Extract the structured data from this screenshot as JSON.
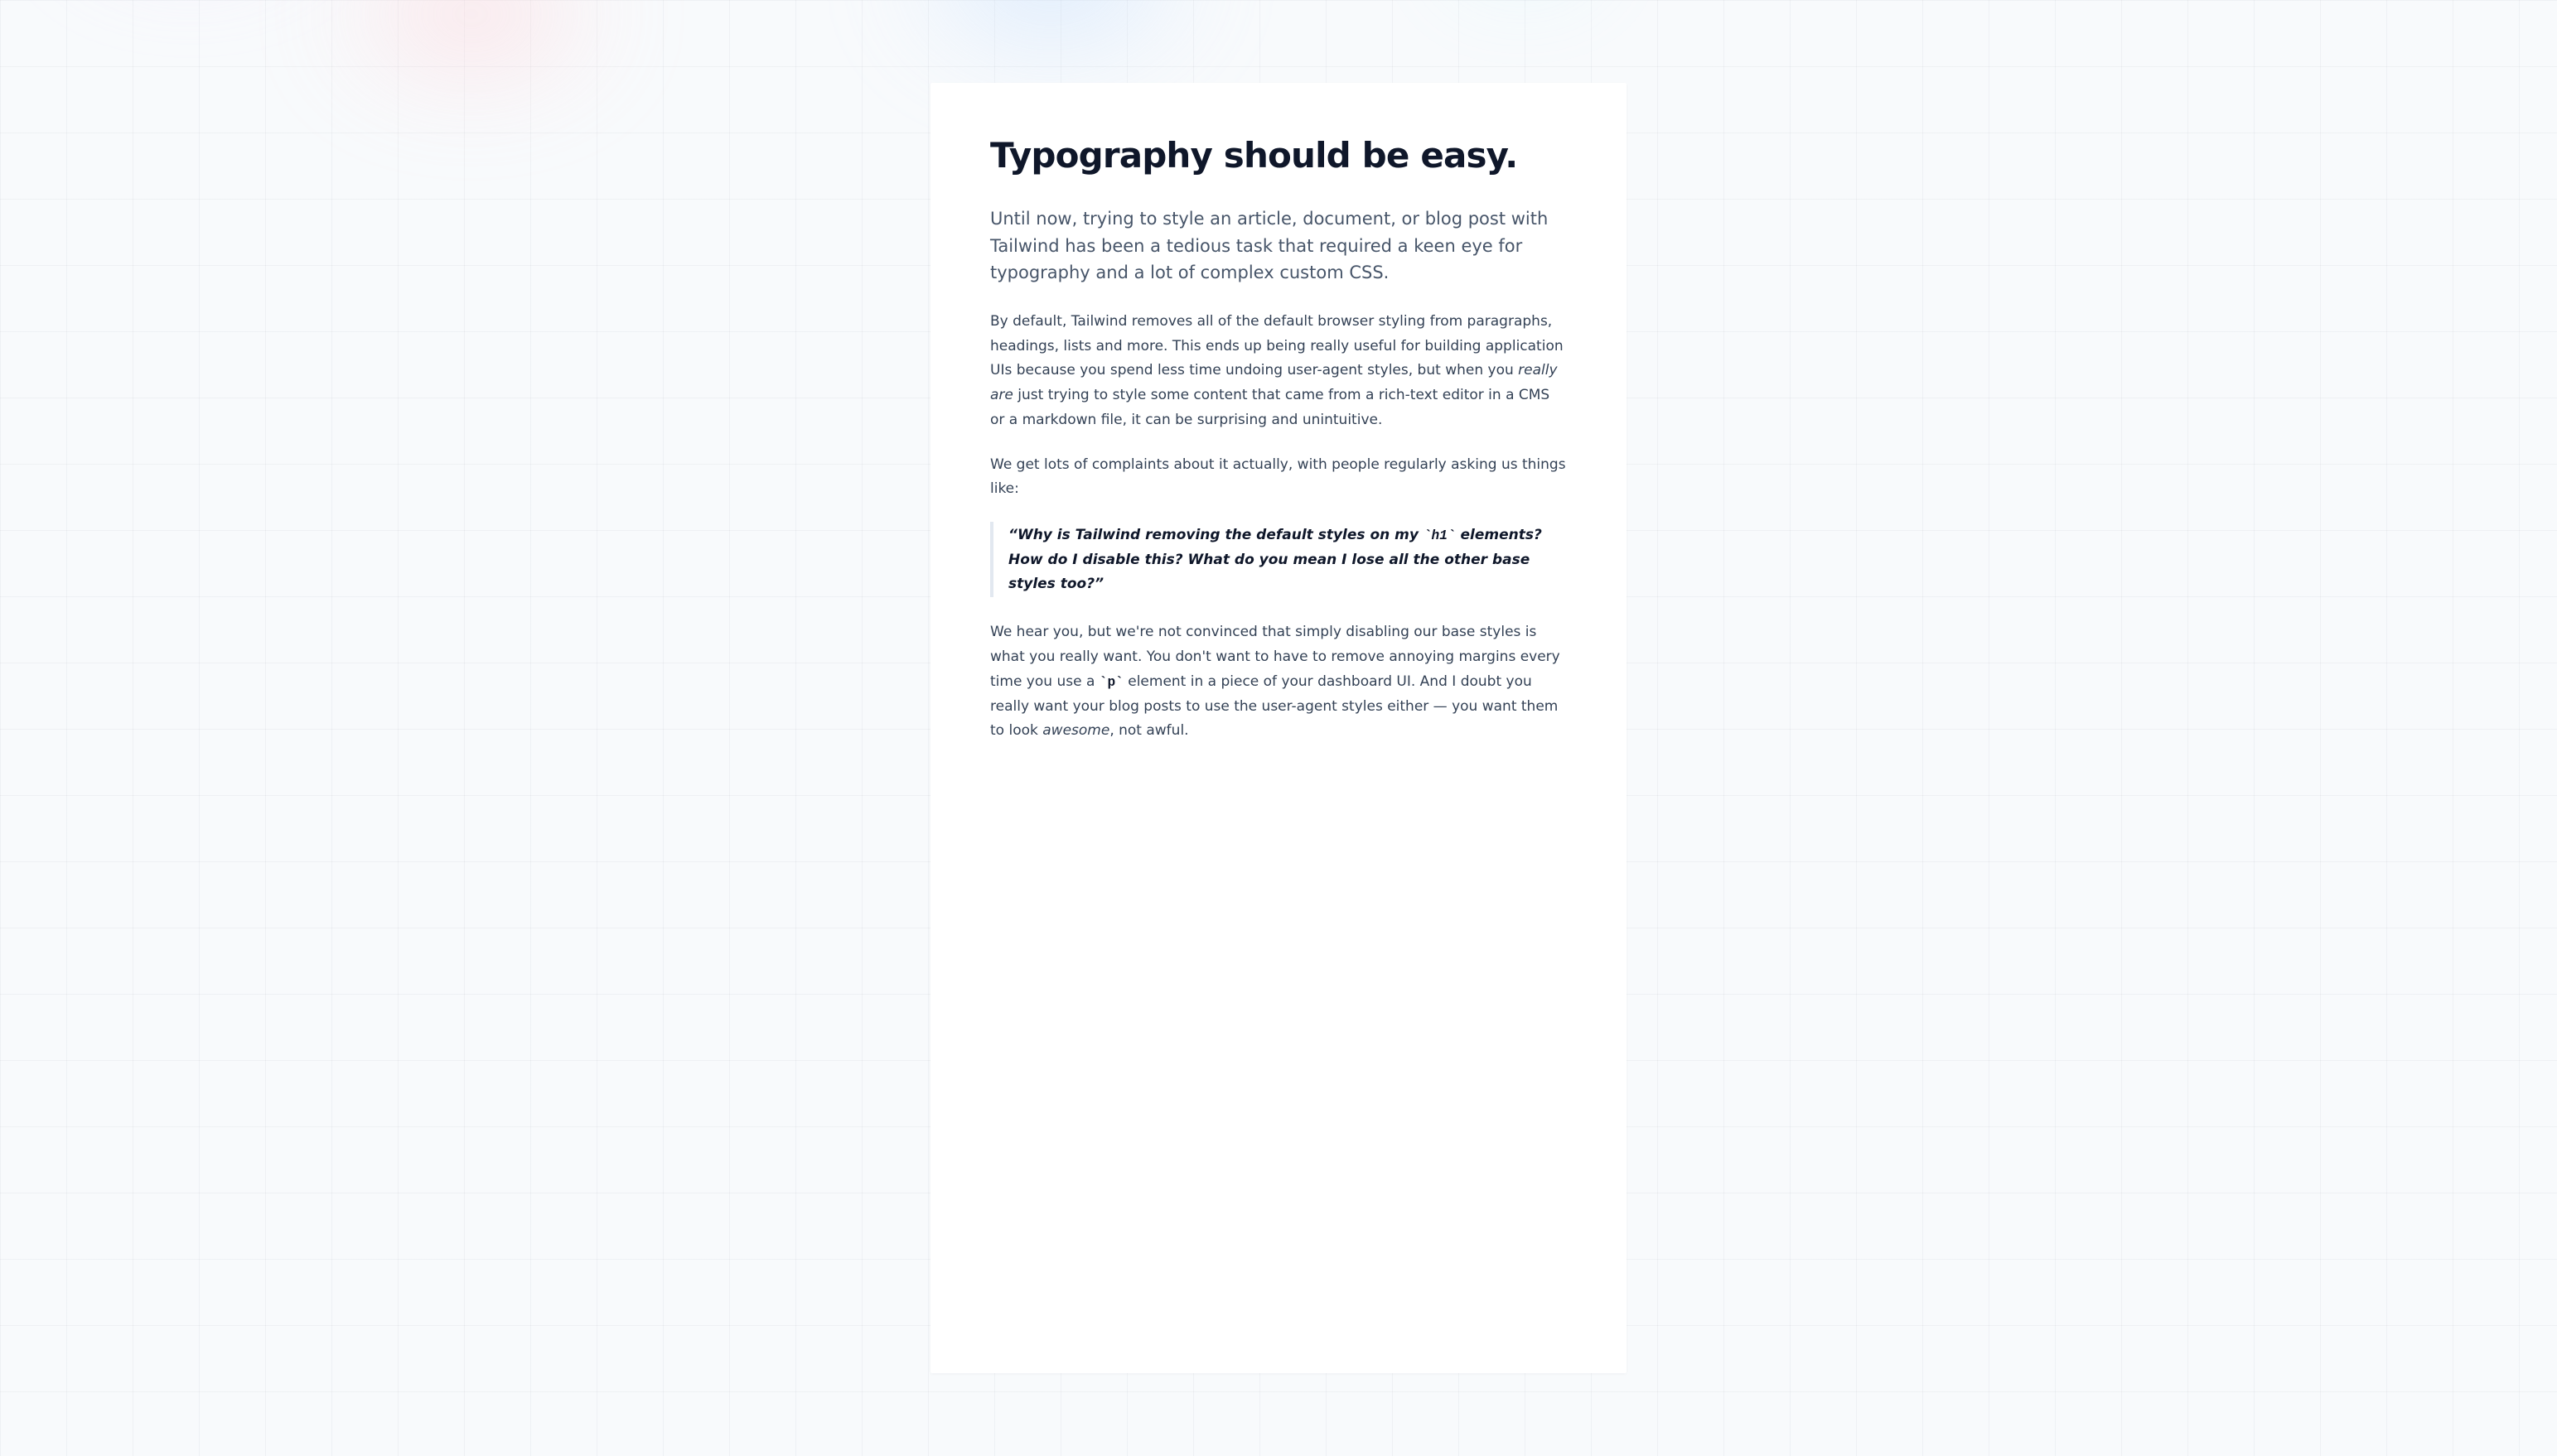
{
  "article": {
    "title": "Typography should be easy.",
    "lead": "Until now, trying to style an article, document, or blog post with Tailwind has been a tedious task that required a keen eye for typography and a lot of complex custom CSS.",
    "p1": {
      "a": "By default, Tailwind removes all of the default browser styling from paragraphs, headings, lists and more. This ends up being really useful for building application UIs because you spend less time undoing user-agent styles, but when you ",
      "em": "really are",
      "b": " just trying to style some content that came from a rich-text editor in a CMS or a markdown file, it can be surprising and unintuitive."
    },
    "p2": "We get lots of complaints about it actually, with people regularly asking us things like:",
    "quote": {
      "a": "“Why is Tailwind removing the default styles on my ",
      "code": "h1",
      "b": " elements? How do I disable this? What do you mean I lose all the other base styles too?”"
    },
    "p3": {
      "a": "We hear you, but we're not convinced that simply disabling our base styles is what you really want. You don't want to have to remove annoying margins every time you use a ",
      "code": "p",
      "b": " element in a piece of your dashboard UI. And I doubt you really want your blog posts to use the user-agent styles either — you want them to look ",
      "em": "awesome",
      "c": ", not awful."
    }
  }
}
